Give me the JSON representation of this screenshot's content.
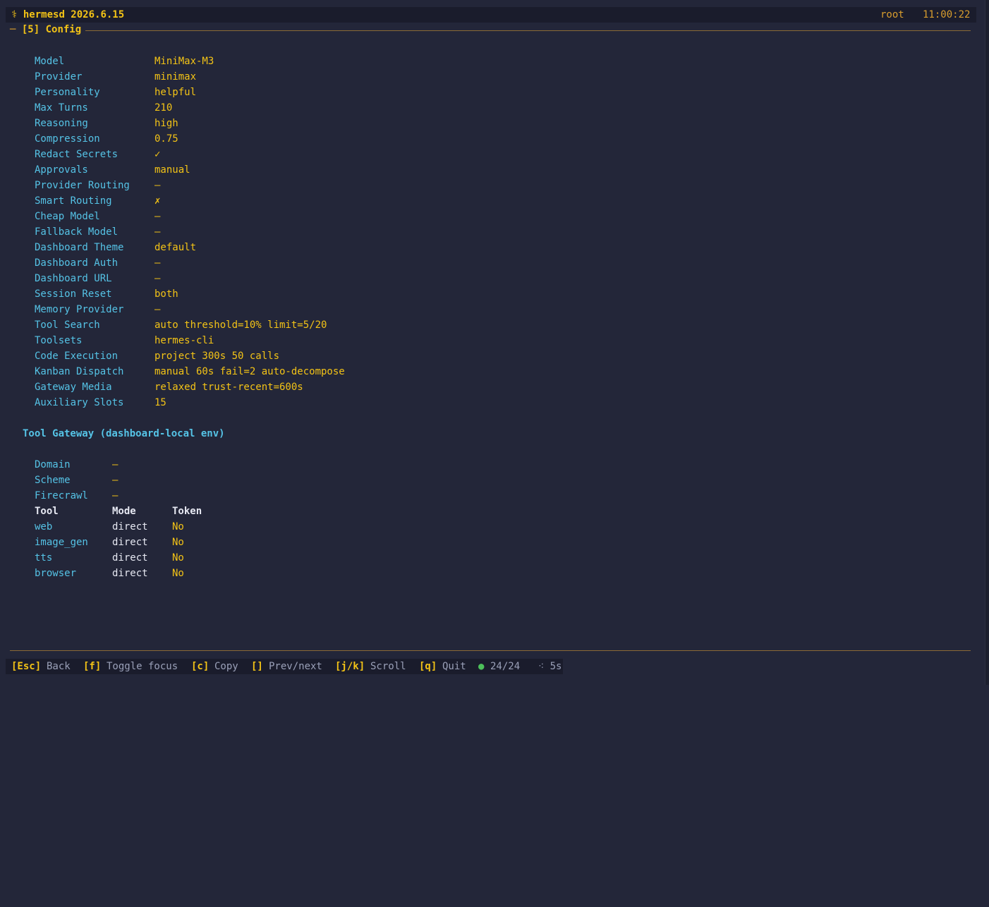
{
  "topbar": {
    "glyph": "⚕",
    "app_name": "hermesd 2026.6.15",
    "user": "root",
    "clock": "11:00:22"
  },
  "section": {
    "dash": "─",
    "title": "[5] Config"
  },
  "config": [
    {
      "key": "Model",
      "value": "MiniMax-M3"
    },
    {
      "key": "Provider",
      "value": "minimax"
    },
    {
      "key": "Personality",
      "value": "helpful"
    },
    {
      "key": "Max Turns",
      "value": "210"
    },
    {
      "key": "Reasoning",
      "value": "high"
    },
    {
      "key": "Compression",
      "value": "0.75"
    },
    {
      "key": "Redact Secrets",
      "value": "✓"
    },
    {
      "key": "Approvals",
      "value": "manual"
    },
    {
      "key": "Provider Routing",
      "value": "—"
    },
    {
      "key": "Smart Routing",
      "value": "✗"
    },
    {
      "key": "Cheap Model",
      "value": "—"
    },
    {
      "key": "Fallback Model",
      "value": "—"
    },
    {
      "key": "Dashboard Theme",
      "value": "default"
    },
    {
      "key": "Dashboard Auth",
      "value": "—"
    },
    {
      "key": "Dashboard URL",
      "value": "—"
    },
    {
      "key": "Session Reset",
      "value": "both"
    },
    {
      "key": "Memory Provider",
      "value": "—"
    },
    {
      "key": "Tool Search",
      "value": "auto threshold=10% limit=5/20"
    },
    {
      "key": "Toolsets",
      "value": "hermes-cli"
    },
    {
      "key": "Code Execution",
      "value": "project 300s 50 calls"
    },
    {
      "key": "Kanban Dispatch",
      "value": "manual 60s fail=2 auto-decompose"
    },
    {
      "key": "Gateway Media",
      "value": "relaxed trust-recent=600s"
    },
    {
      "key": "Auxiliary Slots",
      "value": "15"
    }
  ],
  "tool_gateway": {
    "title": "Tool Gateway (dashboard-local env)",
    "settings": [
      {
        "key": "Domain",
        "value": "—"
      },
      {
        "key": "Scheme",
        "value": "—"
      },
      {
        "key": "Firecrawl",
        "value": "—"
      }
    ],
    "columns": [
      "Tool",
      "Mode",
      "Token"
    ],
    "rows": [
      {
        "tool": "web",
        "mode": "direct",
        "token": "No"
      },
      {
        "tool": "image_gen",
        "mode": "direct",
        "token": "No"
      },
      {
        "tool": "tts",
        "mode": "direct",
        "token": "No"
      },
      {
        "tool": "browser",
        "mode": "direct",
        "token": "No"
      }
    ]
  },
  "footer": {
    "esc_key": "[Esc]",
    "esc_label": "Back",
    "f_key": "[f]",
    "f_label": "Toggle focus",
    "c_key": "[c]",
    "c_label": "Copy",
    "br_key": "[]",
    "br_label": "Prev/next",
    "jk_key": "[j/k]",
    "jk_label": "Scroll",
    "q_key": "[q]",
    "q_label": "Quit",
    "status_dot": "●",
    "count": "24/24",
    "refresh": "⁖ 5s"
  },
  "colors": {
    "background": "#232639",
    "bar": "#1a1c2c",
    "accent": "#f3c316",
    "label": "#55c3e6",
    "rule": "#8b6a36",
    "status": "#4cc05a"
  }
}
